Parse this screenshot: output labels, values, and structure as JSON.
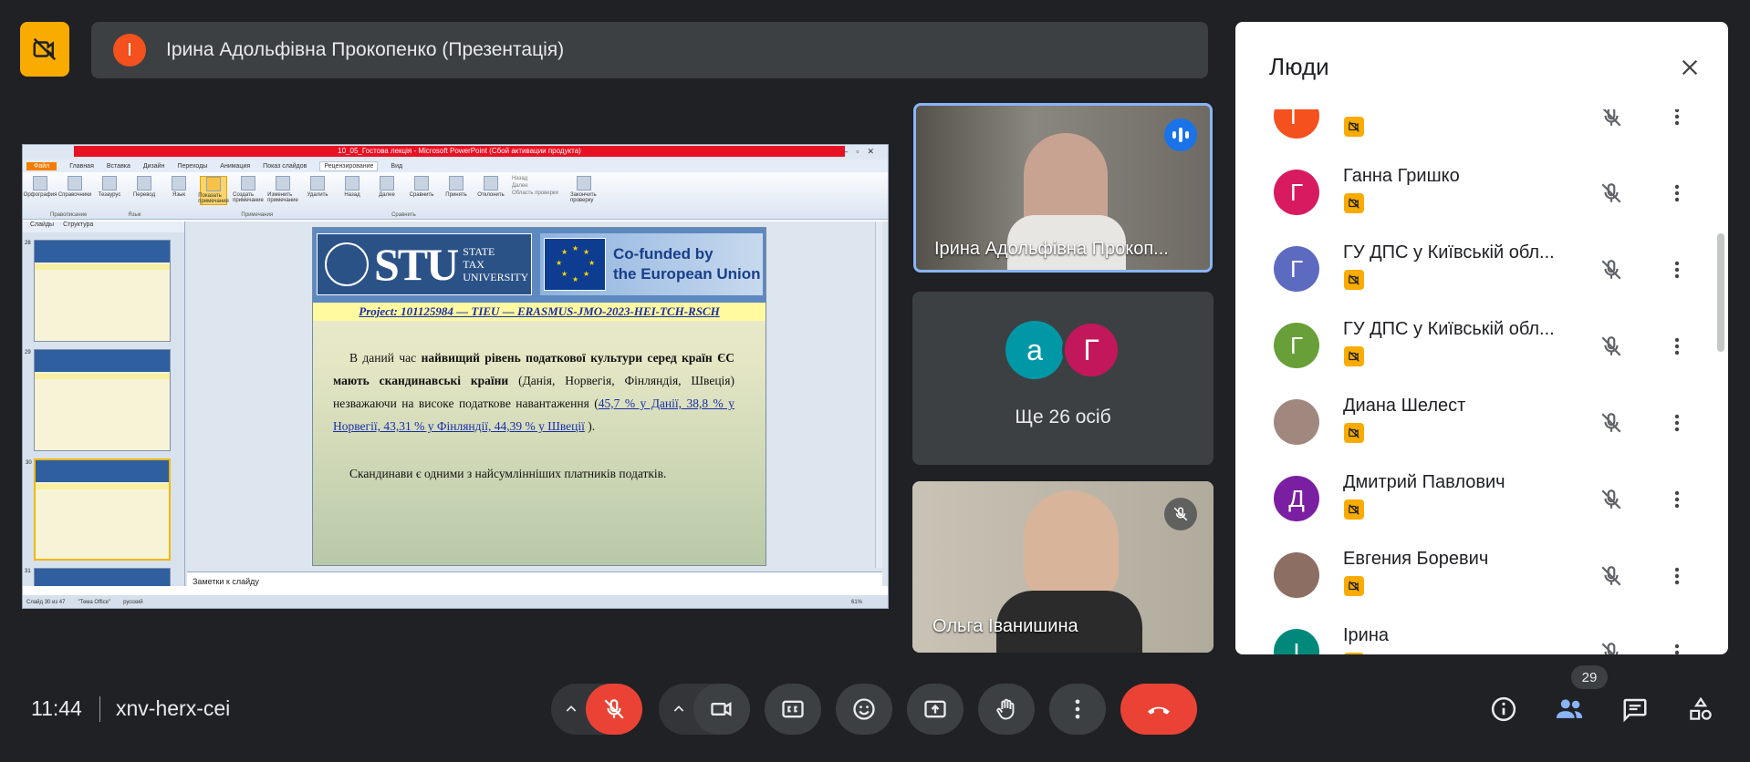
{
  "presenter": {
    "initial": "І",
    "name": "Ірина Адольфівна Прокопенко (Презентація)"
  },
  "ppt": {
    "window_title": "10_05_Гостова лекція - Microsoft PowerPoint (Сбой активации продукта)",
    "tabs": [
      "Файл",
      "Главная",
      "Вставка",
      "Дизайн",
      "Переходы",
      "Анимация",
      "Показ слайдов",
      "Рецензирование",
      "Вид"
    ],
    "ribbon_buttons": [
      "Орфография",
      "Справочники",
      "Тезаурус",
      "Перевод",
      "Язык",
      "Показать примечания",
      "Создать примечание",
      "Изменить примечание",
      "Удалить",
      "Назад",
      "Далее",
      "Сравнить",
      "Принять",
      "Отклонить",
      "Закончить проверку"
    ],
    "ribbon_small": [
      "Назад",
      "Далее",
      "Область проверки"
    ],
    "ribbon_groups": [
      "Правописание",
      "Язык",
      "Примечания",
      "Сравнить"
    ],
    "thumb_tabs": [
      "Слайды",
      "Структура"
    ],
    "thumb_numbers": [
      "28",
      "29",
      "30",
      "31"
    ],
    "notes_placeholder": "Заметки к слайду",
    "status": [
      "Слайд 30 из 47",
      "\"Тема Office\"",
      "русский"
    ],
    "zoom": "61%"
  },
  "slide": {
    "stu_big": "STU",
    "stu_small_1": "STATE",
    "stu_small_2": "TAX",
    "stu_small_3": "UNIVERSITY",
    "eu_line1": "Co-funded by",
    "eu_line2": "the European Union",
    "project": "Project: 101125984 — TIEU — ERASMUS-JMO-2023-HEI-TCH-RSCH",
    "p1_a": "В даний час ",
    "p1_bold": "найвищий рівень податкової культури серед країн ЄС мають скандинавські країни",
    "p1_b": " (Данія, Норвегія, Фінляндія, Швеція) незважаючи на високе податкове навантаження (",
    "p1_link": "45,7 % у Данії, 38,8 % у Норвегії, 43,31 % у Фінляндії, 44,39 % у Швеції",
    "p1_c": " ).",
    "p2": "Скандинави є одними з найсумлінніших платників податків."
  },
  "tiles": {
    "speaker_name": "Ірина Адольфівна Прокоп...",
    "group_initial_1": "а",
    "group_initial_2": "Г",
    "more_people": "Ще 26 осіб",
    "tile3_name": "Ольга Іванишина"
  },
  "panel": {
    "title": "Люди",
    "people": [
      {
        "initial": "Г",
        "name": "",
        "color": "#f4511e"
      },
      {
        "initial": "Г",
        "name": "Ганна Гришко",
        "color": "#d81b60"
      },
      {
        "initial": "Г",
        "name": "ГУ ДПС у Київській обл...",
        "color": "#5c6bc0"
      },
      {
        "initial": "Г",
        "name": "ГУ ДПС у Київській обл...",
        "color": "#689f38"
      },
      {
        "initial": "",
        "name": "Диана Шелест",
        "color": "#a1887f"
      },
      {
        "initial": "Д",
        "name": "Дмитрий Павлович",
        "color": "#7b1fa2"
      },
      {
        "initial": "",
        "name": "Евгения Боревич",
        "color": "#8d6e63"
      },
      {
        "initial": "І",
        "name": "Ірина",
        "color": "#00897b"
      }
    ]
  },
  "bottom": {
    "time": "11:44",
    "meeting_code": "xnv-herx-cei",
    "participants_count": "29"
  },
  "colors": {
    "accent_blue": "#8ab4f8",
    "mute_red": "#ea4335",
    "cam_yellow": "#f9ab00",
    "background": "#202124"
  }
}
